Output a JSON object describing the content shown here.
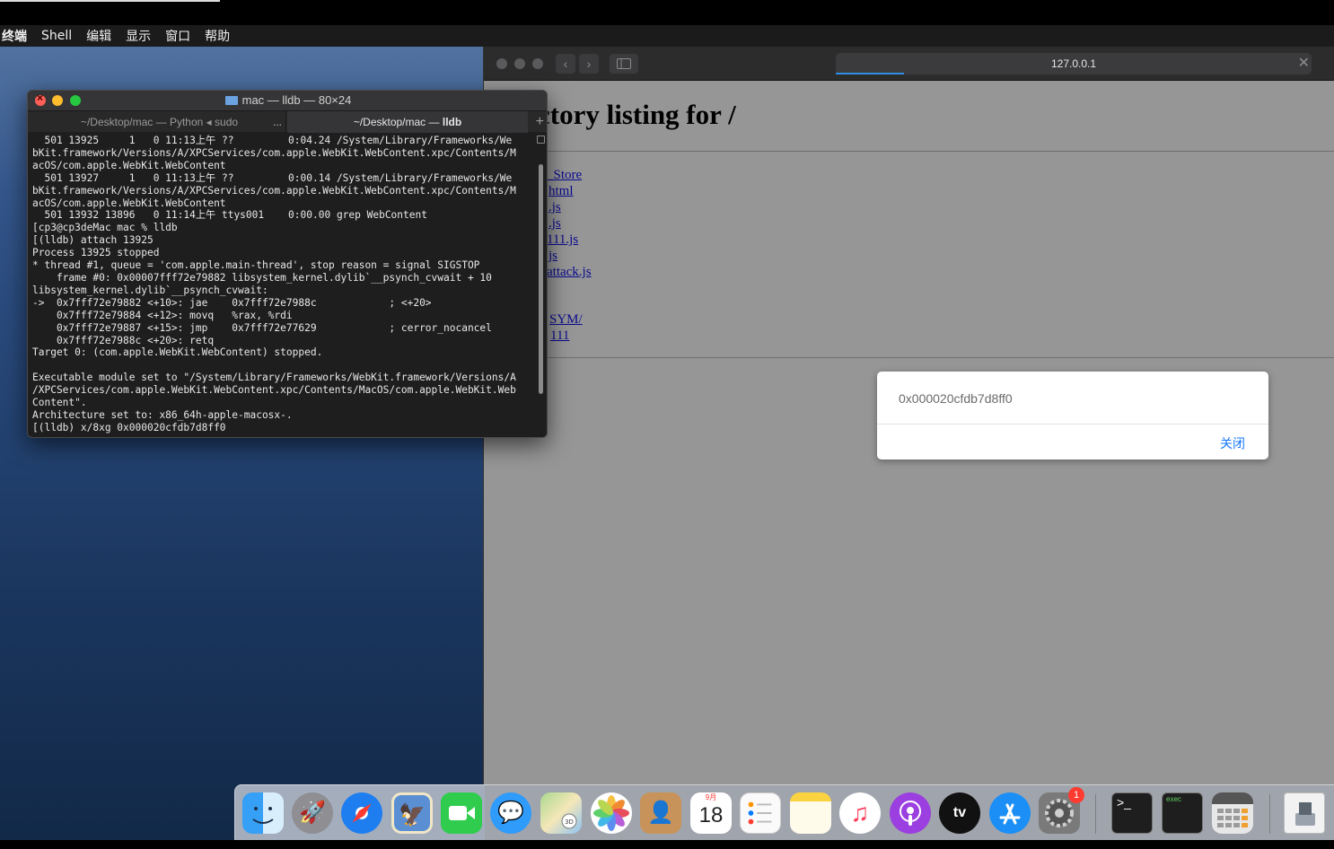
{
  "menubar": {
    "items": [
      "终端",
      "Shell",
      "编辑",
      "显示",
      "窗口",
      "帮助"
    ]
  },
  "browser": {
    "address": "127.0.0.1",
    "page_title": "ctory listing for /",
    "links": [
      "_Store",
      "html",
      ".js",
      ".js",
      "111.js",
      "js",
      "attack.js",
      "SYM/",
      "111"
    ]
  },
  "alert": {
    "message": "0x000020cfdb7d8ff0",
    "close_label": "关闭"
  },
  "terminal": {
    "title": "mac — lldb — 80×24",
    "tabs": [
      {
        "label": "~/Desktop/mac — Python ◂ sudo"
      },
      {
        "label_prefix": "~/Desktop/mac — ",
        "label_bold": "lldb"
      }
    ],
    "tab_more": "...",
    "lines": [
      "  501 13925     1   0 11:13上午 ??         0:04.24 /System/Library/Frameworks/We",
      "bKit.framework/Versions/A/XPCServices/com.apple.WebKit.WebContent.xpc/Contents/M",
      "acOS/com.apple.WebKit.WebContent",
      "  501 13927     1   0 11:13上午 ??         0:00.14 /System/Library/Frameworks/We",
      "bKit.framework/Versions/A/XPCServices/com.apple.WebKit.WebContent.xpc/Contents/M",
      "acOS/com.apple.WebKit.WebContent",
      "  501 13932 13896   0 11:14上午 ttys001    0:00.00 grep WebContent",
      "[cp3@cp3deMac mac % lldb",
      "[(lldb) attach 13925",
      "Process 13925 stopped",
      "* thread #1, queue = 'com.apple.main-thread', stop reason = signal SIGSTOP",
      "    frame #0: 0x00007fff72e79882 libsystem_kernel.dylib`__psynch_cvwait + 10",
      "libsystem_kernel.dylib`__psynch_cvwait:",
      "->  0x7fff72e79882 <+10>: jae    0x7fff72e7988c            ; <+20>",
      "    0x7fff72e79884 <+12>: movq   %rax, %rdi",
      "    0x7fff72e79887 <+15>: jmp    0x7fff72e77629            ; cerror_nocancel",
      "    0x7fff72e7988c <+20>: retq",
      "Target 0: (com.apple.WebKit.WebContent) stopped.",
      "",
      "Executable module set to \"/System/Library/Frameworks/WebKit.framework/Versions/A",
      "/XPCServices/com.apple.WebKit.WebContent.xpc/Contents/MacOS/com.apple.WebKit.Web",
      "Content\".",
      "Architecture set to: x86_64h-apple-macosx-.",
      "[(lldb) x/8xg 0x000020cfdb7d8ff0"
    ]
  },
  "dock": {
    "calendar_month": "9月",
    "calendar_day": "18",
    "settings_badge": "1",
    "tv_label": "tv",
    "exec_label": "exec",
    "apps": [
      "finder",
      "launchpad",
      "safari",
      "preview",
      "facetime",
      "messages",
      "maps",
      "photos",
      "contacts",
      "calendar",
      "reminders",
      "notes",
      "music",
      "podcasts",
      "tv",
      "app-store",
      "system-preferences",
      "terminal",
      "exec",
      "calculator",
      "downloads"
    ],
    "colors": {
      "finder": "#2a8ff2",
      "launchpad": "#8e8e93",
      "safari": "#1e7ef0",
      "facetime": "#2fcc4e",
      "messages": "#2f9bfa",
      "podcasts": "#9b3fe0",
      "tv": "#111111",
      "app_store": "#1b8ff5",
      "system_prefs": "#7a7a7a"
    }
  }
}
